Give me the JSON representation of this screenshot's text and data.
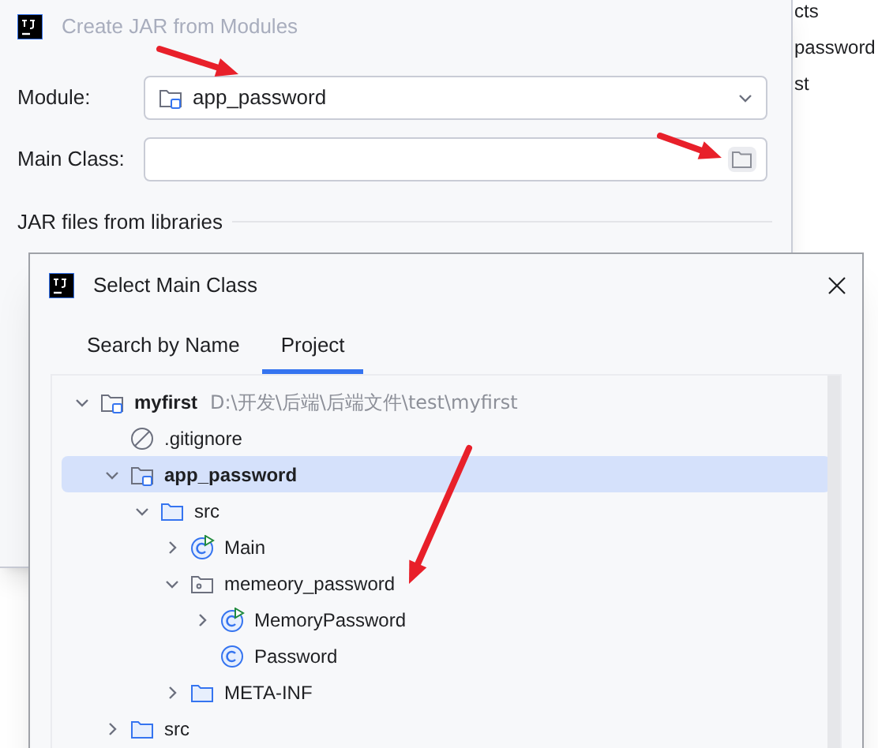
{
  "background_window": {
    "lines": [
      "cts",
      "password",
      "st"
    ]
  },
  "jar_dialog": {
    "title": "Create JAR from Modules",
    "module_label": "Module:",
    "module_value": "app_password",
    "main_class_label": "Main Class:",
    "libraries_heading": "JAR files from libraries"
  },
  "select_dialog": {
    "title": "Select Main Class",
    "tabs": [
      {
        "label": "Search by Name",
        "selected": false
      },
      {
        "label": "Project",
        "selected": true
      }
    ],
    "tree": [
      {
        "kind": "module",
        "label": "myfirst",
        "path": "D:\\开发\\后端\\后端文件\\test\\myfirst",
        "expanded": true,
        "selected": false,
        "children": [
          {
            "kind": "ignored",
            "label": ".gitignore",
            "selected": false
          },
          {
            "kind": "module",
            "label": "app_password",
            "expanded": true,
            "selected": true,
            "children": [
              {
                "kind": "folder",
                "label": "src",
                "expanded": true,
                "selected": false,
                "children": [
                  {
                    "kind": "runnable",
                    "label": "Main",
                    "expanded": false,
                    "selected": false
                  },
                  {
                    "kind": "package",
                    "label": "memeory_password",
                    "expanded": true,
                    "selected": false,
                    "children": [
                      {
                        "kind": "runnable",
                        "label": "MemoryPassword",
                        "expanded": false,
                        "selected": false
                      },
                      {
                        "kind": "class",
                        "label": "Password",
                        "selected": false
                      }
                    ]
                  },
                  {
                    "kind": "folder",
                    "label": "META-INF",
                    "expanded": false,
                    "selected": false
                  }
                ]
              }
            ]
          },
          {
            "kind": "folder",
            "label": "src",
            "expanded": false,
            "selected": false
          }
        ]
      }
    ]
  }
}
